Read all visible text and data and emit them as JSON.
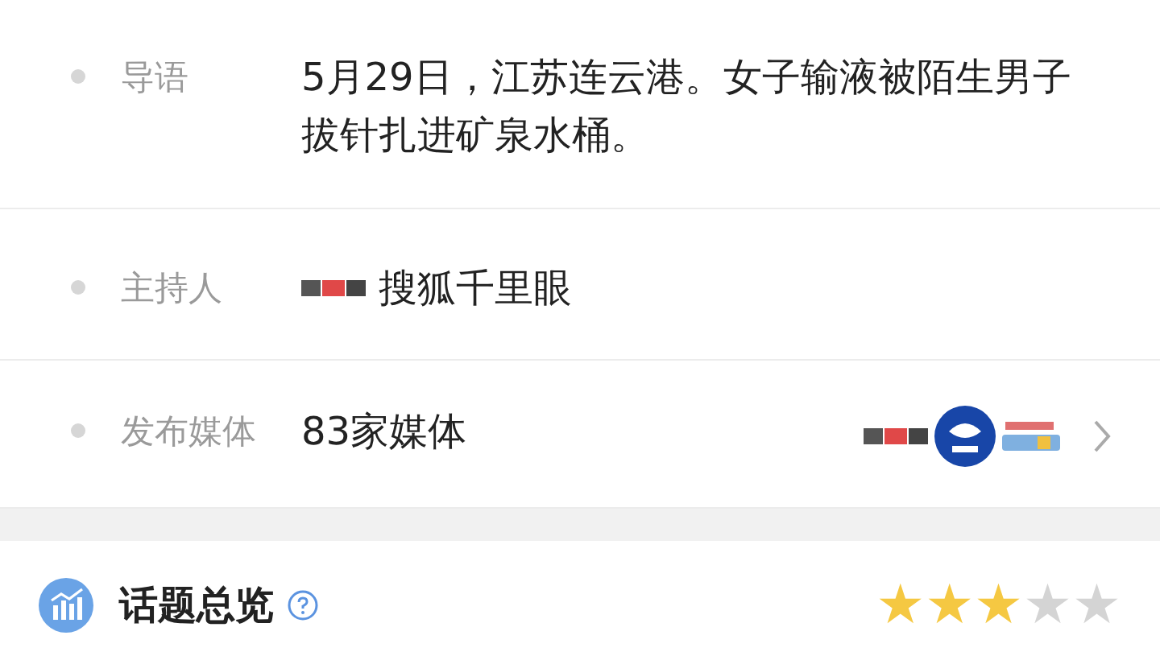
{
  "info_rows": [
    {
      "kind": "text",
      "label": "导语",
      "value": "5月29日，江苏连云港。女子输液被陌生男子拔针扎进矿泉水桶。"
    },
    {
      "kind": "host",
      "label": "主持人",
      "value": "搜狐千里眼"
    },
    {
      "kind": "media",
      "label": "发布媒体",
      "value": "83家媒体"
    }
  ],
  "overview": {
    "title": "话题总览",
    "stars": 3
  }
}
